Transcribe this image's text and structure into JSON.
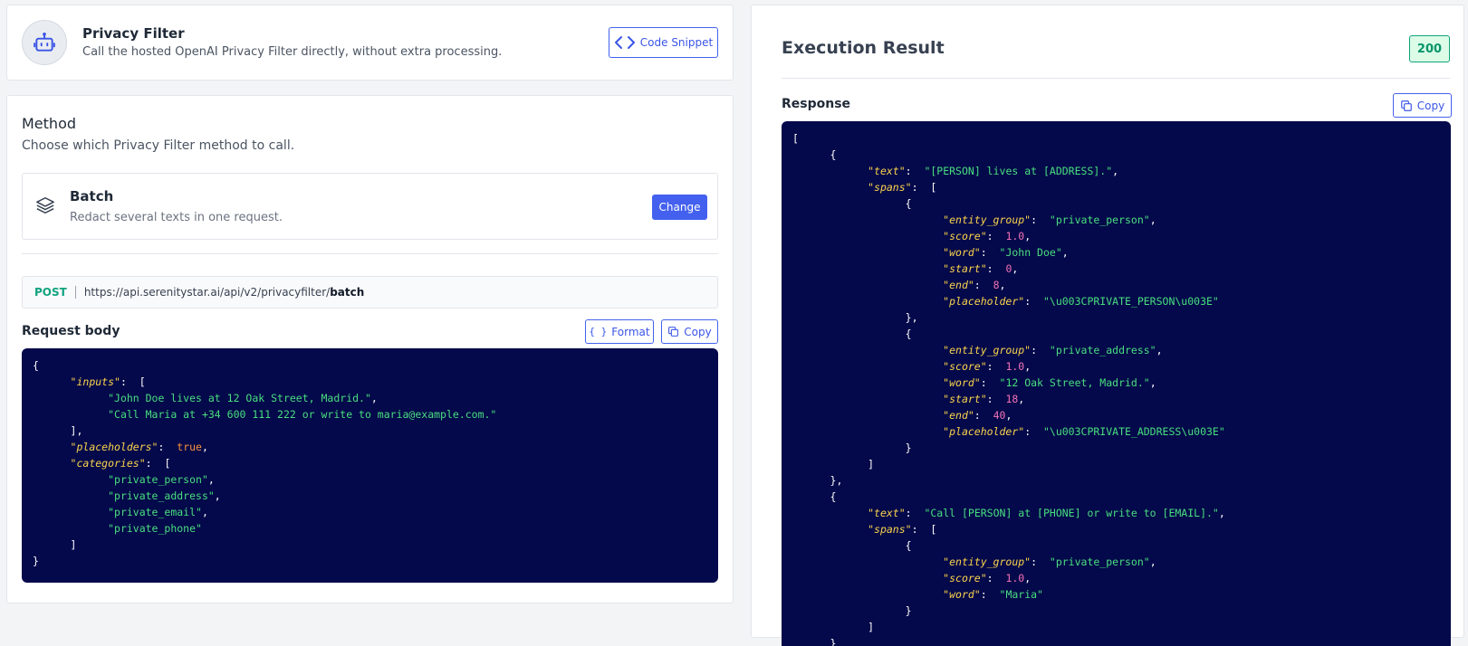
{
  "header": {
    "title": "Privacy Filter",
    "subtitle": "Call the hosted OpenAI Privacy Filter directly, without extra processing.",
    "code_snippet_label": "Code Snippet"
  },
  "method": {
    "title": "Method",
    "subtitle": "Choose which Privacy Filter method to call.",
    "selected": {
      "name": "Batch",
      "description": "Redact several texts in one request.",
      "change_label": "Change"
    }
  },
  "endpoint": {
    "verb": "POST",
    "base_url": "https://api.serenitystar.ai/api/v2/privacyfilter/",
    "path": "batch"
  },
  "request": {
    "title": "Request body",
    "format_label": "Format",
    "copy_label": "Copy",
    "body": {
      "inputs": [
        "John Doe lives at 12 Oak Street, Madrid.",
        "Call Maria at +34 600 111 222 or write to maria@example.com."
      ],
      "placeholders": true,
      "categories": [
        "private_person",
        "private_address",
        "private_email",
        "private_phone"
      ]
    }
  },
  "result": {
    "title": "Execution Result",
    "status_code": "200",
    "response_title": "Response",
    "copy_label": "Copy",
    "response": [
      {
        "text": "[PERSON] lives at [ADDRESS].",
        "spans": [
          {
            "entity_group": "private_person",
            "score": 1.0,
            "word": "John Doe",
            "start": 0,
            "end": 8,
            "placeholder": "\\u003CPRIVATE_PERSON\\u003E"
          },
          {
            "entity_group": "private_address",
            "score": 1.0,
            "word": "12 Oak Street, Madrid.",
            "start": 18,
            "end": 40,
            "placeholder": "\\u003CPRIVATE_ADDRESS\\u003E"
          }
        ]
      },
      {
        "text": "Call [PERSON] at [PHONE] or write to [EMAIL].",
        "spans": [
          {
            "entity_group": "private_person",
            "score": 1.0,
            "word": "Maria"
          }
        ]
      }
    ]
  },
  "colors": {
    "accent": "#4361ee",
    "code_bg": "#03094a",
    "success": "#10a37f"
  }
}
